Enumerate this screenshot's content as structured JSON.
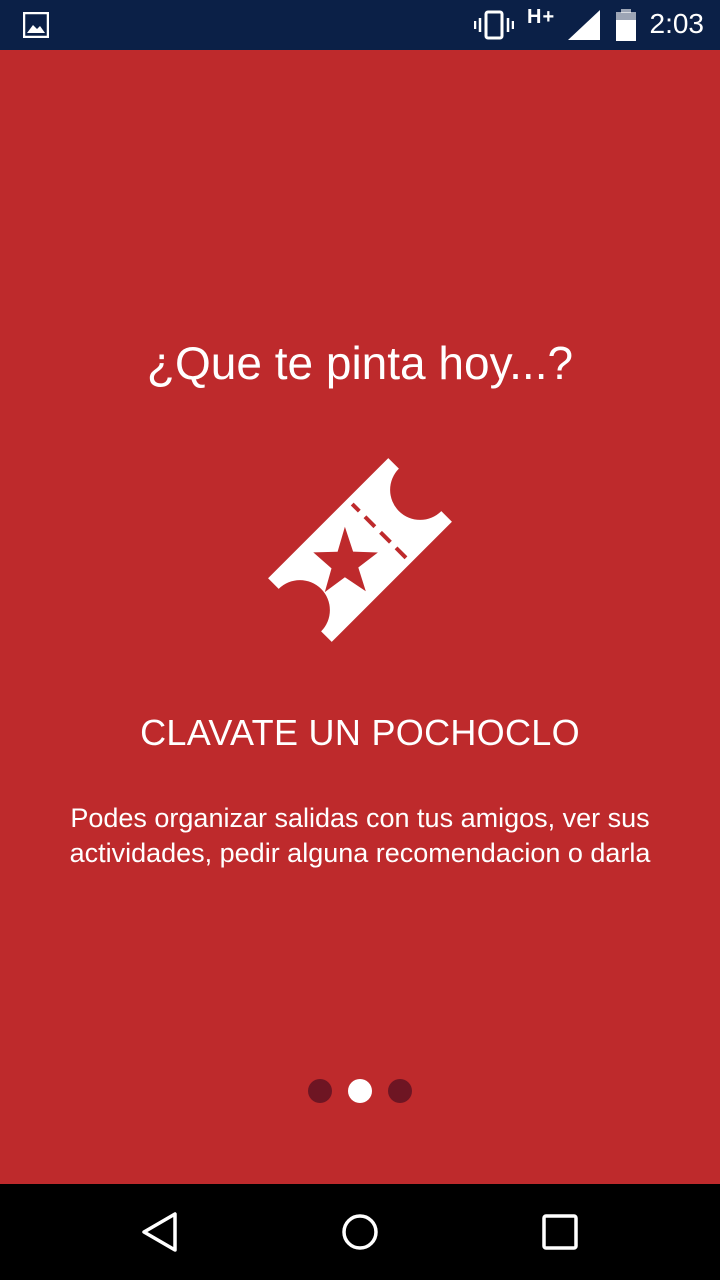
{
  "status_bar": {
    "network": "H+",
    "time": "2:03",
    "icons": [
      "image-notification-icon",
      "vibrate-icon",
      "signal-icon",
      "battery-icon"
    ]
  },
  "onboarding": {
    "headline": "¿Que te pinta hoy...?",
    "icon": "ticket-icon",
    "title": "CLAVATE UN POCHOCLO",
    "description": "Podes organizar salidas con tus amigos, ver sus actividades, pedir alguna recomendacion o darla",
    "pager": {
      "total": 3,
      "active_index": 1
    }
  },
  "nav_bar": {
    "buttons": [
      "back",
      "home",
      "recents"
    ]
  },
  "colors": {
    "background": "#be2a2c",
    "status_bar": "#0b2047",
    "dot_inactive": "#6e1523",
    "dot_active": "#ffffff"
  }
}
